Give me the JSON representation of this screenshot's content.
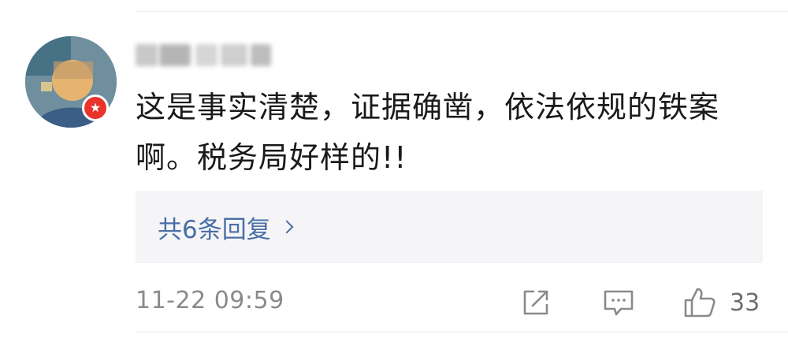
{
  "comment": {
    "text": "这是事实清楚，证据确凿，依法依规的铁案啊。税务局好样的!!",
    "timestamp": "11-22 09:59"
  },
  "replies": {
    "label": "共6条回复"
  },
  "actions": {
    "share_icon": "share-icon",
    "comment_icon": "comment-icon",
    "like_icon": "thumbs-up-icon",
    "like_count": "33"
  },
  "colors": {
    "link_blue": "#4a6fa5",
    "text_dark": "#1a1a1a",
    "text_gray": "#8a8a8a",
    "badge_red": "#e8342a",
    "reply_bg": "#f5f5f7"
  }
}
